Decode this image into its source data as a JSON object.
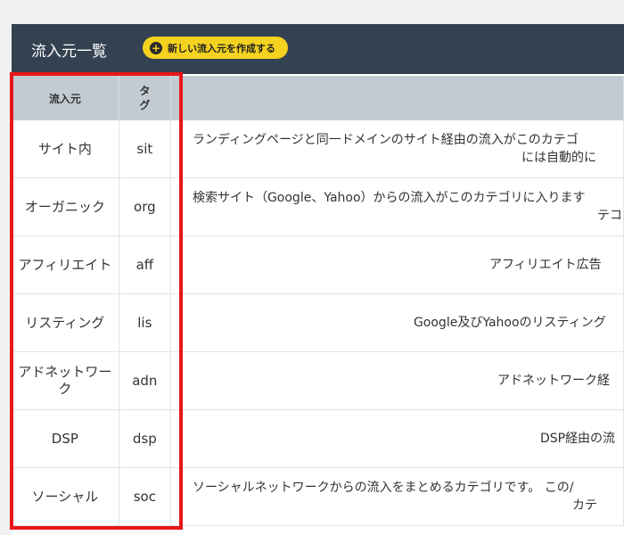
{
  "header": {
    "title": "流入元一覧",
    "create_button_label": "新しい流入元を作成する"
  },
  "table": {
    "columns": [
      "流入元",
      "タグ",
      ""
    ],
    "tag_header_line1": "タ",
    "tag_header_line2": "グ",
    "rows": [
      {
        "source": "サイト内",
        "tag": "sit",
        "desc_line1": "ランディングページと同一ドメインのサイト経由の流入がこのカテゴ",
        "desc_line2": "には自動的に"
      },
      {
        "source": "オーガニック",
        "tag": "org",
        "desc_line1": "検索サイト（Google、Yahoo）からの流入がこのカテゴリに入ります",
        "desc_line2": "テコ"
      },
      {
        "source": "アフィリエイト",
        "tag": "aff",
        "desc_line1": "アフィリエイト広告",
        "desc_line2": ""
      },
      {
        "source": "リスティング",
        "tag": "lis",
        "desc_line1": "Google及びYahooのリスティング",
        "desc_line2": ""
      },
      {
        "source": "アドネットワーク",
        "tag": "adn",
        "desc_line1": "アドネットワーク経",
        "desc_line2": ""
      },
      {
        "source": "DSP",
        "tag": "dsp",
        "desc_line1": "DSP経由の流",
        "desc_line2": ""
      },
      {
        "source": "ソーシャル",
        "tag": "soc",
        "desc_line1": "ソーシャルネットワークからの流入をまとめるカテゴリです。 この/",
        "desc_line2": "カテ"
      }
    ]
  },
  "colors": {
    "header_bg": "#334150",
    "button_bg": "#f4d21f",
    "table_header_bg": "#c3cbd2",
    "highlight_border": "#e8161a"
  }
}
